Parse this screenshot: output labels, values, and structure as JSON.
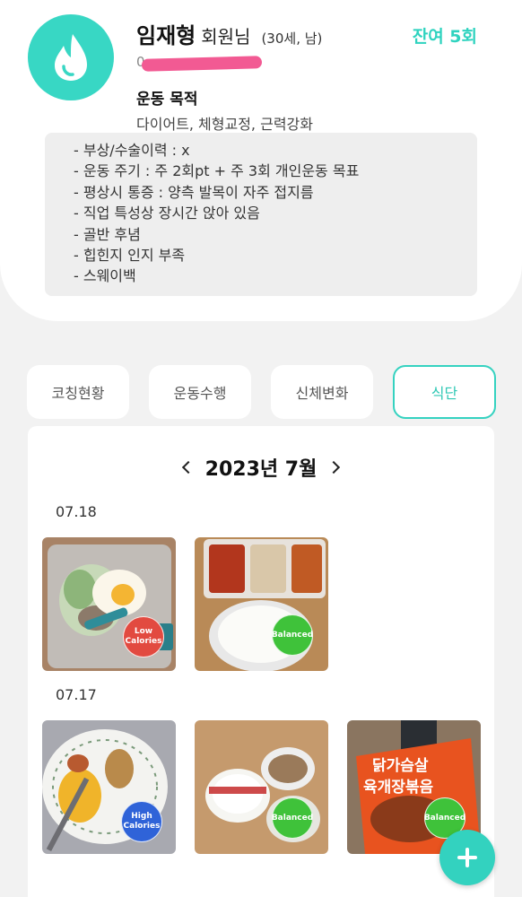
{
  "profile": {
    "name": "임재형",
    "suffix": "회원님",
    "meta": "(30세, 남)",
    "remaining": "잔여 5회",
    "phone_visible": "0",
    "goal_title": "운동 목적",
    "goal_text": "다이어트, 체형교정, 근력강화",
    "notes": [
      "- 부상/수술이력 : x",
      "- 운동 주기 : 주 2회pt + 주 3회 개인운동 목표",
      "- 평상시 통증 : 양측 발목이 자주 접지름",
      "- 직업 특성상 장시간 앉아 있음",
      "- 골반 후념",
      "- 힙힌지 인지 부족",
      "- 스웨이백"
    ]
  },
  "tabs": [
    {
      "label": "코칭현황",
      "active": false
    },
    {
      "label": "운동수행",
      "active": false
    },
    {
      "label": "신체변화",
      "active": false
    },
    {
      "label": "식단",
      "active": true
    }
  ],
  "diet": {
    "month": "2023년 7월",
    "days": [
      {
        "date": "07.18",
        "meals": [
          {
            "badge_line1": "Low",
            "badge_line2": "Calories",
            "badge_color": "#e24a40"
          },
          {
            "badge_line1": "Balanced",
            "badge_line2": "",
            "badge_color": "#3fc23a"
          }
        ]
      },
      {
        "date": "07.17",
        "meals": [
          {
            "badge_line1": "High",
            "badge_line2": "Calories",
            "badge_color": "#2f63d8"
          },
          {
            "badge_line1": "Balanced",
            "badge_line2": "",
            "badge_color": "#3fc23a"
          },
          {
            "badge_line1": "Balanced",
            "badge_line2": "",
            "badge_color": "#3fc23a"
          }
        ]
      }
    ],
    "package_text": [
      "닭가슴살",
      "육개장볶음"
    ]
  },
  "colors": {
    "accent": "#33d2bf"
  }
}
